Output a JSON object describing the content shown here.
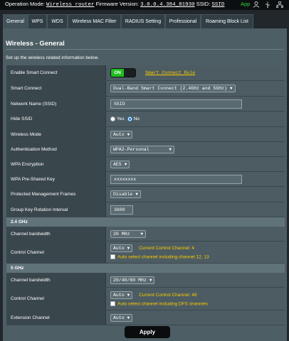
{
  "topbar": {
    "op_mode_label": "Operation Mode:",
    "op_mode_value": "Wireless router",
    "firmware_label": "Firmware Version:",
    "firmware_value": "3.0.0.4.384_81930",
    "ssid_label": "SSID:",
    "ssid_value": "SSID",
    "app_label": "App",
    "icons": [
      "user-icon",
      "usb-icon",
      "network-icon"
    ]
  },
  "tabs": [
    "General",
    "WPS",
    "WDS",
    "Wireless MAC Filter",
    "RADIUS Setting",
    "Professional",
    "Roaming Block List"
  ],
  "page": {
    "title": "Wireless - General",
    "description": "Set up the wireless related information below."
  },
  "general": {
    "smart_connect_label": "Enable Smart Connect",
    "smart_connect_toggle": "ON",
    "smart_connect_rule": "Smart Connect Rule",
    "smart_connect_mode_label": "Smart Connect",
    "smart_connect_mode_value": "Dual-Band Smart Connect (2.4GHz and 5GHz)",
    "ssid_label": "Network Name (SSID)",
    "ssid_value": "SSID",
    "hide_ssid_label": "Hide SSID",
    "hide_ssid_yes": "Yes",
    "hide_ssid_no": "No",
    "hide_ssid_selected": "No",
    "wireless_mode_label": "Wireless Mode",
    "wireless_mode_value": "Auto",
    "auth_label": "Authentication Method",
    "auth_value": "WPA2-Personal",
    "encryption_label": "WPA Encryption",
    "encryption_value": "AES",
    "psk_label": "WPA Pre-Shared Key",
    "psk_value": "xxxxxxxx",
    "pmf_label": "Protected Management Frames",
    "pmf_value": "Disable",
    "rotation_label": "Group Key Rotation Interval",
    "rotation_value": "3600"
  },
  "band_24": {
    "header": "2.4 GHz",
    "bandwidth_label": "Channel bandwidth",
    "bandwidth_value": "20 MHz",
    "control_label": "Control Channel",
    "control_value": "Auto",
    "current_channel": "Current Control Channel: 4",
    "auto_select": "Auto select channel including channel 12, 13"
  },
  "band_5": {
    "header": "5 GHz",
    "bandwidth_label": "Channel bandwidth",
    "bandwidth_value": "20/40/80 MHz",
    "control_label": "Control Channel",
    "control_value": "Auto",
    "current_channel": "Current Control Channel: 48",
    "auto_select": "Auto select channel including DFS channels",
    "extension_label": "Extension Channel",
    "extension_value": "Auto"
  },
  "apply_label": "Apply",
  "colors": {
    "accent_green": "#1fbf1f",
    "link_yellow": "#ffcc00",
    "panel": "#4d5e64",
    "background": "#21272a"
  }
}
